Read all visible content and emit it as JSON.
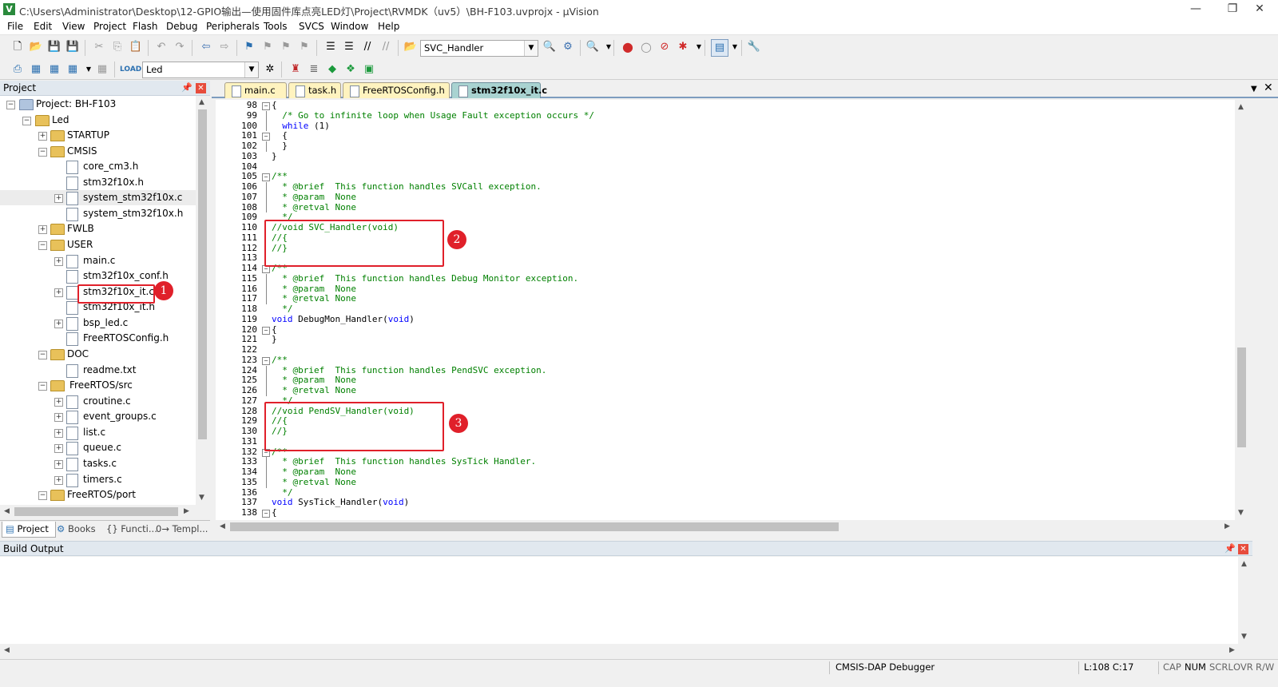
{
  "window": {
    "title": "C:\\Users\\Administrator\\Desktop\\12-GPIO输出—使用固件库点亮LED灯\\Project\\RVMDK（uv5）\\BH-F103.uvprojx - µVision",
    "minimize": "—",
    "restore": "❐",
    "close": "✕"
  },
  "menu": [
    "File",
    "Edit",
    "View",
    "Project",
    "Flash",
    "Debug",
    "Peripherals",
    "Tools",
    "SVCS",
    "Window",
    "Help"
  ],
  "toolbar": {
    "function_combo": "SVC_Handler",
    "target_combo": "Led"
  },
  "project_panel": {
    "title": "Project",
    "tree": [
      {
        "label": "Project: BH-F103",
        "type": "root"
      },
      {
        "label": "Led",
        "type": "target"
      },
      {
        "label": "STARTUP",
        "type": "group"
      },
      {
        "label": "CMSIS",
        "type": "group"
      },
      {
        "label": "core_cm3.h",
        "type": "file"
      },
      {
        "label": "stm32f10x.h",
        "type": "file"
      },
      {
        "label": "system_stm32f10x.c",
        "type": "file"
      },
      {
        "label": "system_stm32f10x.h",
        "type": "file"
      },
      {
        "label": "FWLB",
        "type": "group"
      },
      {
        "label": "USER",
        "type": "group"
      },
      {
        "label": "main.c",
        "type": "file"
      },
      {
        "label": "stm32f10x_conf.h",
        "type": "file"
      },
      {
        "label": "stm32f10x_it.c",
        "type": "file"
      },
      {
        "label": "stm32f10x_it.h",
        "type": "file"
      },
      {
        "label": "bsp_led.c",
        "type": "file"
      },
      {
        "label": "FreeRTOSConfig.h",
        "type": "file"
      },
      {
        "label": "DOC",
        "type": "group"
      },
      {
        "label": "readme.txt",
        "type": "file"
      },
      {
        "label": "FreeRTOS/src",
        "type": "group"
      },
      {
        "label": "croutine.c",
        "type": "file"
      },
      {
        "label": "event_groups.c",
        "type": "file"
      },
      {
        "label": "list.c",
        "type": "file"
      },
      {
        "label": "queue.c",
        "type": "file"
      },
      {
        "label": "tasks.c",
        "type": "file"
      },
      {
        "label": "timers.c",
        "type": "file"
      },
      {
        "label": "FreeRTOS/port",
        "type": "group"
      }
    ],
    "tabs": [
      "Project",
      "Books",
      "{} Functi...",
      "0→ Templ..."
    ]
  },
  "editor": {
    "tabs": [
      "main.c",
      "task.h",
      "FreeRTOSConfig.h",
      "stm32f10x_it.c"
    ],
    "active_tab": "stm32f10x_it.c",
    "lines": [
      {
        "n": "98",
        "t": "{"
      },
      {
        "n": "99",
        "t": "  /* Go to infinite loop when Usage Fault exception occurs */"
      },
      {
        "n": "100",
        "t": "  while (1)"
      },
      {
        "n": "101",
        "t": "  {"
      },
      {
        "n": "102",
        "t": "  }"
      },
      {
        "n": "103",
        "t": "}"
      },
      {
        "n": "104",
        "t": ""
      },
      {
        "n": "105",
        "t": "/**"
      },
      {
        "n": "106",
        "t": "  * @brief  This function handles SVCall exception."
      },
      {
        "n": "107",
        "t": "  * @param  None"
      },
      {
        "n": "108",
        "t": "  * @retval None"
      },
      {
        "n": "109",
        "t": "  */"
      },
      {
        "n": "110",
        "t": "//void SVC_Handler(void)"
      },
      {
        "n": "111",
        "t": "//{"
      },
      {
        "n": "112",
        "t": "//}"
      },
      {
        "n": "113",
        "t": ""
      },
      {
        "n": "114",
        "t": "/**"
      },
      {
        "n": "115",
        "t": "  * @brief  This function handles Debug Monitor exception."
      },
      {
        "n": "116",
        "t": "  * @param  None"
      },
      {
        "n": "117",
        "t": "  * @retval None"
      },
      {
        "n": "118",
        "t": "  */"
      },
      {
        "n": "119",
        "t": "void DebugMon_Handler(void)"
      },
      {
        "n": "120",
        "t": "{"
      },
      {
        "n": "121",
        "t": "}"
      },
      {
        "n": "122",
        "t": ""
      },
      {
        "n": "123",
        "t": "/**"
      },
      {
        "n": "124",
        "t": "  * @brief  This function handles PendSVC exception."
      },
      {
        "n": "125",
        "t": "  * @param  None"
      },
      {
        "n": "126",
        "t": "  * @retval None"
      },
      {
        "n": "127",
        "t": "  */"
      },
      {
        "n": "128",
        "t": "//void PendSV_Handler(void)"
      },
      {
        "n": "129",
        "t": "//{"
      },
      {
        "n": "130",
        "t": "//}"
      },
      {
        "n": "131",
        "t": ""
      },
      {
        "n": "132",
        "t": "/**"
      },
      {
        "n": "133",
        "t": "  * @brief  This function handles SysTick Handler."
      },
      {
        "n": "134",
        "t": "  * @param  None"
      },
      {
        "n": "135",
        "t": "  * @retval None"
      },
      {
        "n": "136",
        "t": "  */"
      },
      {
        "n": "137",
        "t": "void SysTick_Handler(void)"
      },
      {
        "n": "138",
        "t": "{"
      }
    ]
  },
  "annotations": [
    "1",
    "2",
    "3"
  ],
  "annotation_color": "#e0202a",
  "build_output": {
    "title": "Build Output",
    "content": ""
  },
  "status": {
    "debugger": "CMSIS-DAP Debugger",
    "position": "L:108 C:17",
    "indicators": [
      "CAP",
      "NUM",
      "SCRL",
      "OVR",
      "R/W"
    ]
  }
}
